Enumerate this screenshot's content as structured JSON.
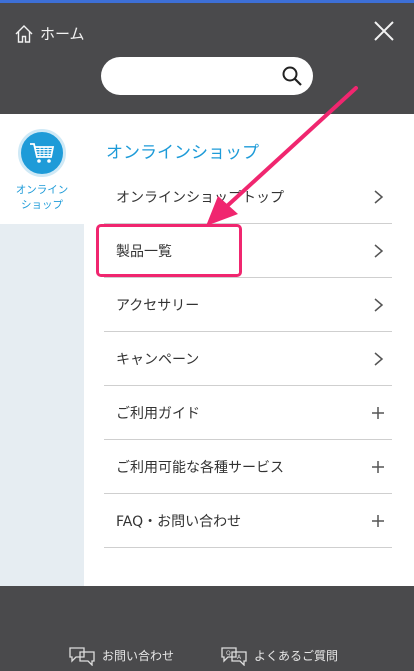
{
  "header": {
    "home_label": "ホーム",
    "search_placeholder": ""
  },
  "sidebar": {
    "tab_label_line1": "オンライン",
    "tab_label_line2": "ショップ"
  },
  "section": {
    "title": "オンラインショップ"
  },
  "menu": [
    {
      "label": "オンラインショップトップ",
      "icon": "chevron-right"
    },
    {
      "label": "製品一覧",
      "icon": "chevron-right"
    },
    {
      "label": "アクセサリー",
      "icon": "chevron-right"
    },
    {
      "label": "キャンペーン",
      "icon": "chevron-right"
    },
    {
      "label": "ご利用ガイド",
      "icon": "plus"
    },
    {
      "label": "ご利用可能な各種サービス",
      "icon": "plus"
    },
    {
      "label": "FAQ・お問い合わせ",
      "icon": "plus"
    }
  ],
  "footer": {
    "contact_label": "お問い合わせ",
    "faq_label": "よくあるご質問"
  },
  "colors": {
    "accent": "#1e9bd8",
    "highlight": "#f0266f",
    "header_bg": "#4a4a4c"
  }
}
